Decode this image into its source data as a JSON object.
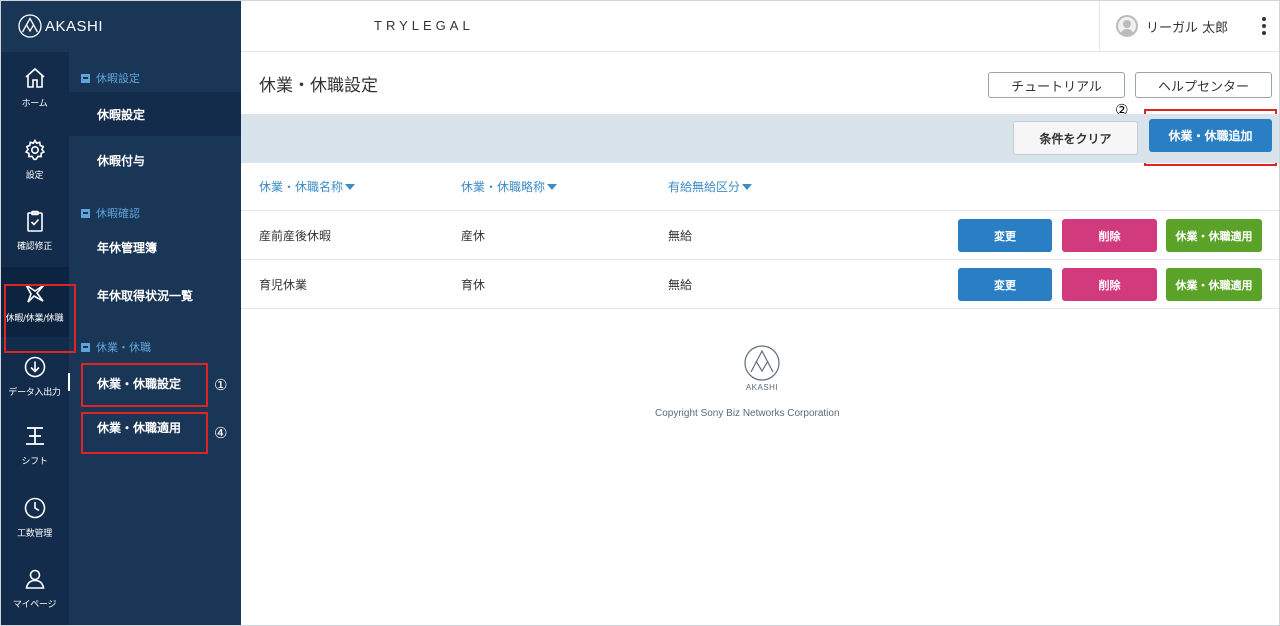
{
  "app": {
    "logo_text": "AKASHI",
    "brand": "TRYLEGAL"
  },
  "user": {
    "name": "リーガル 太郎"
  },
  "rail": [
    {
      "label": "ホーム",
      "icon": "home-icon"
    },
    {
      "label": "設定",
      "icon": "gear-icon"
    },
    {
      "label": "確認修正",
      "icon": "clipboard-check-icon"
    },
    {
      "label": "休暇/休業/休職",
      "icon": "vacation-icon"
    },
    {
      "label": "データ入出力",
      "icon": "download-icon"
    },
    {
      "label": "シフト",
      "icon": "shift-icon"
    },
    {
      "label": "工数管理",
      "icon": "clock-icon"
    },
    {
      "label": "マイページ",
      "icon": "person-icon"
    }
  ],
  "subnav": {
    "sections": [
      {
        "title": "休暇設定",
        "items": [
          "休暇設定",
          "休暇付与"
        ]
      },
      {
        "title": "休暇確認",
        "items": [
          "年休管理簿",
          "年休取得状況一覧"
        ]
      },
      {
        "title": "休業・休職",
        "items": [
          "休業・休職設定",
          "休業・休職適用"
        ]
      }
    ]
  },
  "annotations": {
    "one": "①",
    "two": "②",
    "four": "④"
  },
  "main": {
    "title": "休業・休職設定",
    "tutorial_button": "チュートリアル",
    "help_button": "ヘルプセンター",
    "clear_button": "条件をクリア",
    "add_button": "休業・休職追加",
    "columns": [
      "休業・休職名称",
      "休業・休職略称",
      "有給無給区分"
    ],
    "rows": [
      {
        "name": "産前産後休暇",
        "short": "産休",
        "paid": "無給"
      },
      {
        "name": "育児休業",
        "short": "育休",
        "paid": "無給"
      }
    ],
    "row_buttons": {
      "edit": "変更",
      "delete": "削除",
      "apply": "休業・休職適用"
    }
  },
  "footer": {
    "logo_text": "AKASHI",
    "copyright": "Copyright Sony Biz Networks Corporation"
  }
}
